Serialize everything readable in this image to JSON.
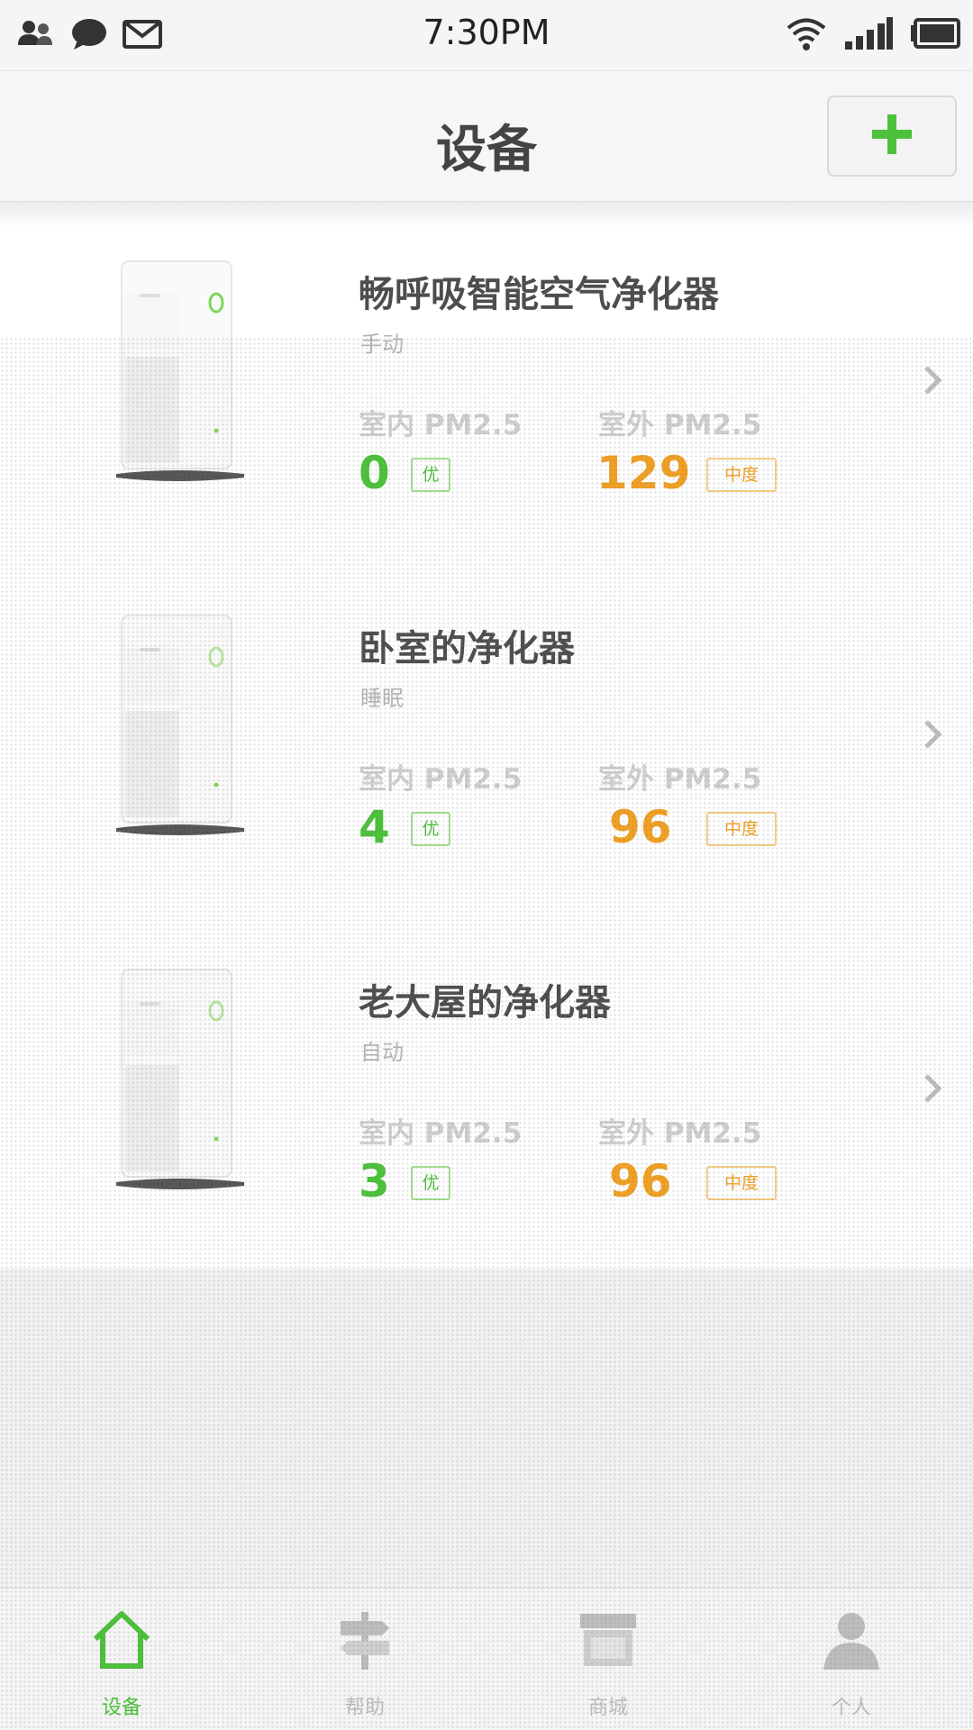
{
  "status_bar": {
    "time": "7:30PM",
    "left_icons": [
      "contacts-icon",
      "chat-bubble-icon",
      "mail-icon"
    ],
    "right_icons": [
      "wifi-icon",
      "signal-icon",
      "battery-icon"
    ]
  },
  "header": {
    "title": "设备",
    "add_button_icon": "plus-icon"
  },
  "devices": [
    {
      "name": "畅呼吸智能空气净化器",
      "mode": "手动",
      "indoor_label": "室内 PM2.5",
      "indoor_value": "0",
      "indoor_quality": "优",
      "outdoor_label": "室外 PM2.5",
      "outdoor_value": "129",
      "outdoor_quality": "中度"
    },
    {
      "name": "卧室的净化器",
      "mode": "睡眠",
      "indoor_label": "室内 PM2.5",
      "indoor_value": "4",
      "indoor_quality": "优",
      "outdoor_label": "室外 PM2.5",
      "outdoor_value": "96",
      "outdoor_quality": "中度"
    },
    {
      "name": "老大屋的净化器",
      "mode": "自动",
      "indoor_label": "室内 PM2.5",
      "indoor_value": "3",
      "indoor_quality": "优",
      "outdoor_label": "室外 PM2.5",
      "outdoor_value": "96",
      "outdoor_quality": "中度"
    }
  ],
  "tabs": [
    {
      "label": "设备",
      "icon": "home-icon",
      "active": true
    },
    {
      "label": "帮助",
      "icon": "signpost-icon",
      "active": false
    },
    {
      "label": "商城",
      "icon": "store-icon",
      "active": false
    },
    {
      "label": "个人",
      "icon": "person-icon",
      "active": false
    }
  ],
  "colors": {
    "accent_green": "#4cc13a",
    "outdoor_orange": "#f0a023",
    "tab_inactive": "#bdbdbd"
  }
}
